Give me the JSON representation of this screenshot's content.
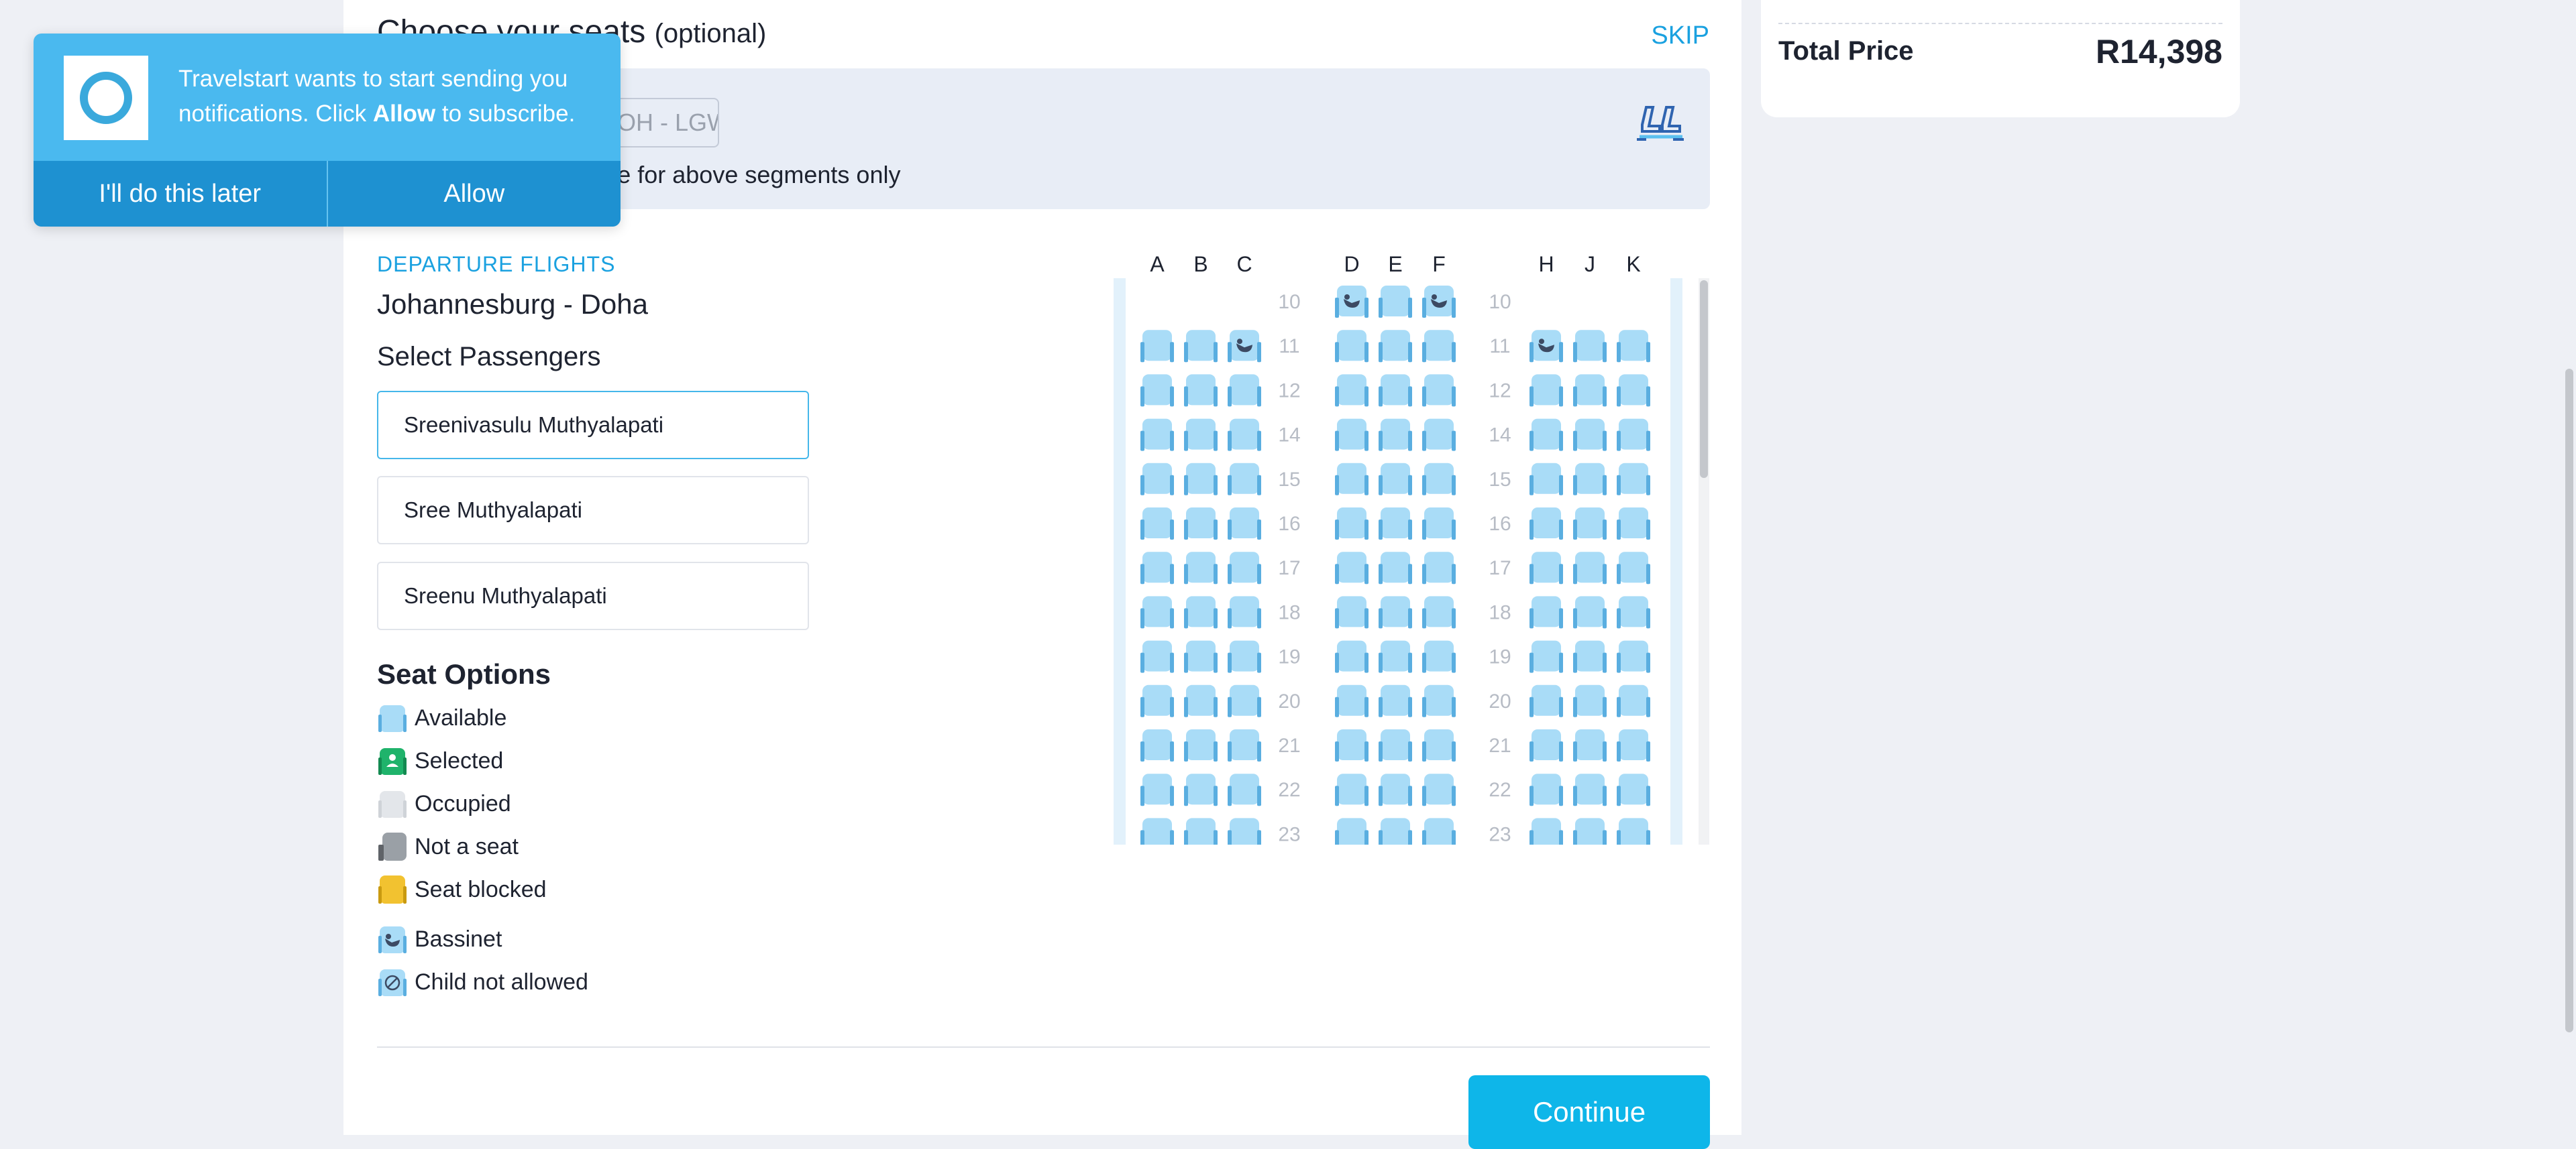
{
  "header": {
    "title": "Choose your seats",
    "title_optional": "(optional)",
    "skip_label": "SKIP"
  },
  "segment": {
    "chip_label": "DOH - LGW",
    "note": "Seat selection available for above segments only"
  },
  "notification": {
    "text_before": "Travelstart wants to start sending you notifications. Click ",
    "text_bold": "Allow",
    "text_after": " to subscribe.",
    "later_label": "I'll do this later",
    "allow_label": "Allow"
  },
  "summary": {
    "total_label": "Total Price",
    "total_value": "R14,398"
  },
  "flight": {
    "direction_label": "DEPARTURE FLIGHTS",
    "route": "Johannesburg - Doha"
  },
  "passengers": {
    "heading": "Select Passengers",
    "items": [
      {
        "name": "Sreenivasulu Muthyalapati",
        "selected": true
      },
      {
        "name": "Sree Muthyalapati",
        "selected": false
      },
      {
        "name": "Sreenu Muthyalapati",
        "selected": false
      }
    ]
  },
  "seat_options": {
    "heading": "Seat Options",
    "items": [
      {
        "label": "Available",
        "icon": "available-seat-icon"
      },
      {
        "label": "Selected",
        "icon": "selected-seat-icon"
      },
      {
        "label": "Occupied",
        "icon": "occupied-seat-icon"
      },
      {
        "label": "Not a seat",
        "icon": "not-a-seat-icon"
      },
      {
        "label": "Seat blocked",
        "icon": "blocked-seat-icon"
      },
      {
        "label": "Bassinet",
        "icon": "bassinet-icon"
      },
      {
        "label": "Child not allowed",
        "icon": "child-not-allowed-icon"
      }
    ]
  },
  "seatmap": {
    "columns": [
      "A",
      "B",
      "C",
      "",
      "D",
      "E",
      "F",
      "",
      "H",
      "J",
      "K"
    ],
    "rows": [
      {
        "number": "10",
        "left": [
          "",
          "",
          ""
        ],
        "middle": [
          "bassinet",
          "available",
          "bassinet"
        ],
        "right": [
          "",
          "",
          ""
        ]
      },
      {
        "number": "11",
        "left": [
          "available",
          "available",
          "bassinet"
        ],
        "middle": [
          "available",
          "available",
          "available"
        ],
        "right": [
          "bassinet",
          "available",
          "available"
        ]
      },
      {
        "number": "12",
        "left": [
          "available",
          "available",
          "available"
        ],
        "middle": [
          "available",
          "available",
          "available"
        ],
        "right": [
          "available",
          "available",
          "available"
        ]
      },
      {
        "number": "14",
        "left": [
          "available",
          "available",
          "available"
        ],
        "middle": [
          "available",
          "available",
          "available"
        ],
        "right": [
          "available",
          "available",
          "available"
        ]
      },
      {
        "number": "15",
        "left": [
          "available",
          "available",
          "available"
        ],
        "middle": [
          "available",
          "available",
          "available"
        ],
        "right": [
          "available",
          "available",
          "available"
        ]
      },
      {
        "number": "16",
        "left": [
          "available",
          "available",
          "available"
        ],
        "middle": [
          "available",
          "available",
          "available"
        ],
        "right": [
          "available",
          "available",
          "available"
        ]
      },
      {
        "number": "17",
        "left": [
          "available",
          "available",
          "available"
        ],
        "middle": [
          "available",
          "available",
          "available"
        ],
        "right": [
          "available",
          "available",
          "available"
        ]
      },
      {
        "number": "18",
        "left": [
          "available",
          "available",
          "available"
        ],
        "middle": [
          "available",
          "available",
          "available"
        ],
        "right": [
          "available",
          "available",
          "available"
        ]
      },
      {
        "number": "19",
        "left": [
          "available",
          "available",
          "available"
        ],
        "middle": [
          "available",
          "available",
          "available"
        ],
        "right": [
          "available",
          "available",
          "available"
        ]
      },
      {
        "number": "20",
        "left": [
          "available",
          "available",
          "available"
        ],
        "middle": [
          "available",
          "available",
          "available"
        ],
        "right": [
          "available",
          "available",
          "available"
        ]
      },
      {
        "number": "21",
        "left": [
          "available",
          "available",
          "available"
        ],
        "middle": [
          "available",
          "available",
          "available"
        ],
        "right": [
          "available",
          "available",
          "available"
        ]
      },
      {
        "number": "22",
        "left": [
          "available",
          "available",
          "available"
        ],
        "middle": [
          "available",
          "available",
          "available"
        ],
        "right": [
          "available",
          "available",
          "available"
        ]
      },
      {
        "number": "23",
        "left": [
          "available",
          "available",
          "available"
        ],
        "middle": [
          "available",
          "available",
          "available"
        ],
        "right": [
          "available",
          "available",
          "available"
        ]
      }
    ]
  },
  "actions": {
    "continue_label": "Continue"
  },
  "colors": {
    "accent": "#1aa1e0",
    "seat_available": "#a9dcf7",
    "seat_selected": "#1fb36b",
    "seat_occupied": "#e3e6ea",
    "not_a_seat": "#9aa0a6",
    "seat_blocked": "#f2c230",
    "continue": "#0eb6e9"
  }
}
